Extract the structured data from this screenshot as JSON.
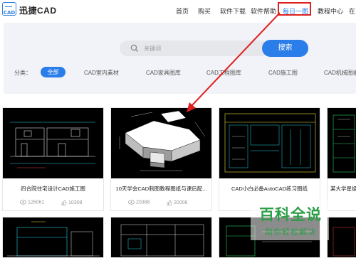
{
  "header": {
    "site_name": "迅捷CAD",
    "logo_text": "CAD",
    "nav": [
      "首页",
      "购买",
      "软件下载",
      "软件帮助",
      "每日一图",
      "教程中心",
      "在"
    ],
    "active_nav": "每日一图"
  },
  "search": {
    "placeholder": "关键词",
    "button_label": "搜索"
  },
  "categories": {
    "label": "分类：",
    "items": [
      "全部",
      "CAD室内素材",
      "CAD家具图库",
      "CAD工程图库",
      "CAD施工图",
      "CAD机械图纸"
    ],
    "selected": "全部"
  },
  "cards": [
    {
      "title": "四合院住宅设计CAD施工图",
      "views": "126061",
      "likes": "10308"
    },
    {
      "title": "10天学会CAD制图教程图纸与课后配...",
      "views": "20388",
      "likes": "20006"
    },
    {
      "title": "CAD小白必备AutoCAD练习图纸",
      "views": "",
      "likes": ""
    },
    {
      "title": "某大学星级...",
      "views": "",
      "likes": ""
    }
  ],
  "watermark": {
    "title": "百科全说",
    "subtitle": "助你轻松解决"
  },
  "colors": {
    "accent": "#2b7de9",
    "highlight_box": "#e02020",
    "watermark": "#2e9e48"
  }
}
